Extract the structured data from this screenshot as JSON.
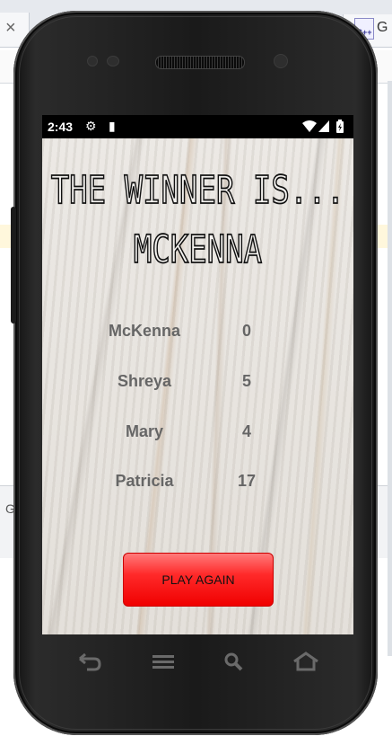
{
  "background": {
    "tab_close": "×",
    "tab_icon_text": "C++",
    "tab_letter": "G",
    "lower_letter": "G"
  },
  "status_bar": {
    "time": "2:43",
    "icons": [
      "gear-icon",
      "sd-card-icon",
      "wifi-icon",
      "signal-icon",
      "battery-icon"
    ]
  },
  "app": {
    "title_line1": "THE WINNER IS...",
    "title_line2": "MCKENNA",
    "scores": [
      {
        "name": "McKenna",
        "score": "0"
      },
      {
        "name": "Shreya",
        "score": "5"
      },
      {
        "name": "Mary",
        "score": "4"
      },
      {
        "name": "Patricia",
        "score": "17"
      }
    ],
    "play_again_label": "PLAY AGAIN",
    "colors": {
      "button": "#ff1a1a",
      "text_gray": "#666666"
    }
  },
  "nav_bar": {
    "icons": [
      "back-icon",
      "menu-icon",
      "search-icon",
      "home-icon"
    ]
  }
}
